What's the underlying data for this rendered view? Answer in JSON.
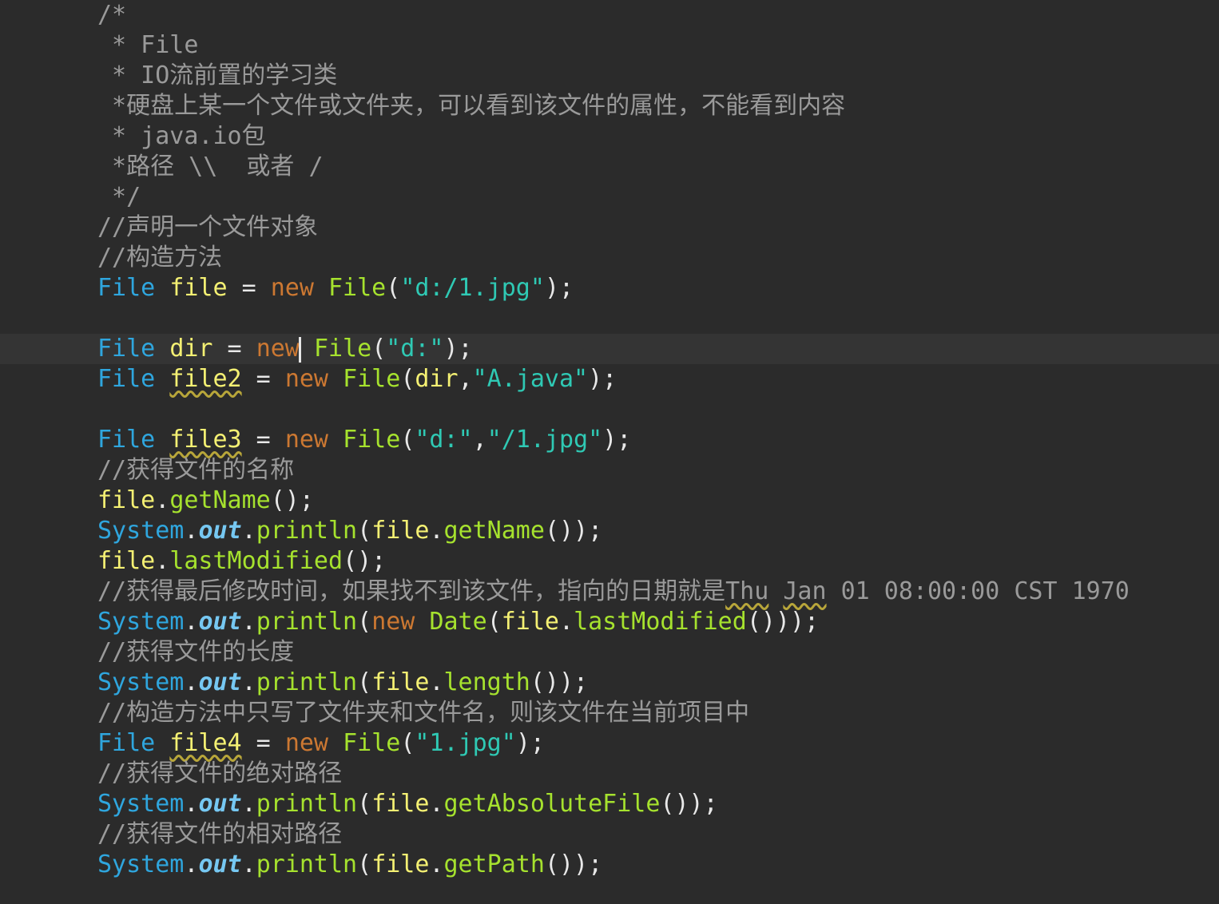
{
  "editor": {
    "current_line": 11,
    "caret_line": 11,
    "caret_after_token": 4,
    "lines": [
      [
        {
          "t": "/*",
          "c": "comment"
        }
      ],
      [
        {
          "t": " * File",
          "c": "comment"
        }
      ],
      [
        {
          "t": " * IO流前置的学习类",
          "c": "comment"
        }
      ],
      [
        {
          "t": " *硬盘上某一个文件或文件夹，可以看到该文件的属性，不能看到内容",
          "c": "comment"
        }
      ],
      [
        {
          "t": " * java.io包",
          "c": "comment"
        }
      ],
      [
        {
          "t": " *路径 \\\\  或者 /",
          "c": "comment"
        }
      ],
      [
        {
          "t": " */",
          "c": "comment"
        }
      ],
      [
        {
          "t": "//声明一个文件对象",
          "c": "comment"
        }
      ],
      [
        {
          "t": "//构造方法",
          "c": "comment"
        }
      ],
      [
        {
          "t": "File",
          "c": "type"
        },
        {
          "t": " ",
          "c": "plain"
        },
        {
          "t": "file",
          "c": "var"
        },
        {
          "t": " = ",
          "c": "punct"
        },
        {
          "t": "new",
          "c": "keyword"
        },
        {
          "t": " ",
          "c": "plain"
        },
        {
          "t": "File",
          "c": "method"
        },
        {
          "t": "(",
          "c": "punct"
        },
        {
          "t": "\"d:/1.jpg\"",
          "c": "string"
        },
        {
          "t": ");",
          "c": "punct"
        }
      ],
      [],
      [
        {
          "t": "File",
          "c": "type"
        },
        {
          "t": " ",
          "c": "plain"
        },
        {
          "t": "dir",
          "c": "var"
        },
        {
          "t": " = ",
          "c": "punct"
        },
        {
          "t": "new",
          "c": "keyword"
        },
        {
          "t": " ",
          "c": "plain"
        },
        {
          "t": "File",
          "c": "method"
        },
        {
          "t": "(",
          "c": "punct"
        },
        {
          "t": "\"d:\"",
          "c": "string"
        },
        {
          "t": ");",
          "c": "punct"
        }
      ],
      [
        {
          "t": "File",
          "c": "type"
        },
        {
          "t": " ",
          "c": "plain"
        },
        {
          "t": "file2",
          "c": "var",
          "w": 1
        },
        {
          "t": " = ",
          "c": "punct"
        },
        {
          "t": "new",
          "c": "keyword"
        },
        {
          "t": " ",
          "c": "plain"
        },
        {
          "t": "File",
          "c": "method"
        },
        {
          "t": "(",
          "c": "punct"
        },
        {
          "t": "dir",
          "c": "var"
        },
        {
          "t": ",",
          "c": "punct"
        },
        {
          "t": "\"A.java\"",
          "c": "string"
        },
        {
          "t": ");",
          "c": "punct"
        }
      ],
      [],
      [
        {
          "t": "File",
          "c": "type"
        },
        {
          "t": " ",
          "c": "plain"
        },
        {
          "t": "file3",
          "c": "var",
          "w": 1
        },
        {
          "t": " = ",
          "c": "punct"
        },
        {
          "t": "new",
          "c": "keyword"
        },
        {
          "t": " ",
          "c": "plain"
        },
        {
          "t": "File",
          "c": "method"
        },
        {
          "t": "(",
          "c": "punct"
        },
        {
          "t": "\"d:\"",
          "c": "string"
        },
        {
          "t": ",",
          "c": "punct"
        },
        {
          "t": "\"/1.jpg\"",
          "c": "string"
        },
        {
          "t": ");",
          "c": "punct"
        }
      ],
      [
        {
          "t": "//获得文件的名称",
          "c": "comment"
        }
      ],
      [
        {
          "t": "file",
          "c": "var"
        },
        {
          "t": ".",
          "c": "punct"
        },
        {
          "t": "getName",
          "c": "method"
        },
        {
          "t": "();",
          "c": "punct"
        }
      ],
      [
        {
          "t": "System",
          "c": "type"
        },
        {
          "t": ".",
          "c": "punct"
        },
        {
          "t": "out",
          "c": "field"
        },
        {
          "t": ".",
          "c": "punct"
        },
        {
          "t": "println",
          "c": "method"
        },
        {
          "t": "(",
          "c": "punct"
        },
        {
          "t": "file",
          "c": "var"
        },
        {
          "t": ".",
          "c": "punct"
        },
        {
          "t": "getName",
          "c": "method"
        },
        {
          "t": "());",
          "c": "punct"
        }
      ],
      [
        {
          "t": "file",
          "c": "var"
        },
        {
          "t": ".",
          "c": "punct"
        },
        {
          "t": "lastModified",
          "c": "method"
        },
        {
          "t": "();",
          "c": "punct"
        }
      ],
      [
        {
          "t": "//获得最后修改时间，如果找不到该文件，指向的日期就是",
          "c": "comment"
        },
        {
          "t": "Thu",
          "c": "comment",
          "w": 1
        },
        {
          "t": " ",
          "c": "comment"
        },
        {
          "t": "Jan",
          "c": "comment",
          "w": 1
        },
        {
          "t": " 01 08:00:00 CST 1970",
          "c": "comment"
        }
      ],
      [
        {
          "t": "System",
          "c": "type"
        },
        {
          "t": ".",
          "c": "punct"
        },
        {
          "t": "out",
          "c": "field"
        },
        {
          "t": ".",
          "c": "punct"
        },
        {
          "t": "println",
          "c": "method"
        },
        {
          "t": "(",
          "c": "punct"
        },
        {
          "t": "new",
          "c": "keyword"
        },
        {
          "t": " ",
          "c": "plain"
        },
        {
          "t": "Date",
          "c": "method"
        },
        {
          "t": "(",
          "c": "punct"
        },
        {
          "t": "file",
          "c": "var"
        },
        {
          "t": ".",
          "c": "punct"
        },
        {
          "t": "lastModified",
          "c": "method"
        },
        {
          "t": "()));",
          "c": "punct"
        }
      ],
      [
        {
          "t": "//获得文件的长度",
          "c": "comment"
        }
      ],
      [
        {
          "t": "System",
          "c": "type"
        },
        {
          "t": ".",
          "c": "punct"
        },
        {
          "t": "out",
          "c": "field"
        },
        {
          "t": ".",
          "c": "punct"
        },
        {
          "t": "println",
          "c": "method"
        },
        {
          "t": "(",
          "c": "punct"
        },
        {
          "t": "file",
          "c": "var"
        },
        {
          "t": ".",
          "c": "punct"
        },
        {
          "t": "length",
          "c": "method"
        },
        {
          "t": "());",
          "c": "punct"
        }
      ],
      [
        {
          "t": "//构造方法中只写了文件夹和文件名，则该文件在当前项目中",
          "c": "comment"
        }
      ],
      [
        {
          "t": "File",
          "c": "type"
        },
        {
          "t": " ",
          "c": "plain"
        },
        {
          "t": "file4",
          "c": "var",
          "w": 1
        },
        {
          "t": " = ",
          "c": "punct"
        },
        {
          "t": "new",
          "c": "keyword"
        },
        {
          "t": " ",
          "c": "plain"
        },
        {
          "t": "File",
          "c": "method"
        },
        {
          "t": "(",
          "c": "punct"
        },
        {
          "t": "\"1.jpg\"",
          "c": "string"
        },
        {
          "t": ");",
          "c": "punct"
        }
      ],
      [
        {
          "t": "//获得文件的绝对路径",
          "c": "comment"
        }
      ],
      [
        {
          "t": "System",
          "c": "type"
        },
        {
          "t": ".",
          "c": "punct"
        },
        {
          "t": "out",
          "c": "field"
        },
        {
          "t": ".",
          "c": "punct"
        },
        {
          "t": "println",
          "c": "method"
        },
        {
          "t": "(",
          "c": "punct"
        },
        {
          "t": "file",
          "c": "var"
        },
        {
          "t": ".",
          "c": "punct"
        },
        {
          "t": "getAbsoluteFile",
          "c": "method"
        },
        {
          "t": "());",
          "c": "punct"
        }
      ],
      [
        {
          "t": "//获得文件的相对路径",
          "c": "comment"
        }
      ],
      [
        {
          "t": "System",
          "c": "type"
        },
        {
          "t": ".",
          "c": "punct"
        },
        {
          "t": "out",
          "c": "field"
        },
        {
          "t": ".",
          "c": "punct"
        },
        {
          "t": "println",
          "c": "method"
        },
        {
          "t": "(",
          "c": "punct"
        },
        {
          "t": "file",
          "c": "var"
        },
        {
          "t": ".",
          "c": "punct"
        },
        {
          "t": "getPath",
          "c": "method"
        },
        {
          "t": "());",
          "c": "punct"
        }
      ]
    ]
  },
  "theme": {
    "background": "#2b2b2b",
    "current_line": "#343434",
    "comment": "#9a9a9a",
    "type": "#2fa6de",
    "keyword": "#cc7832",
    "variable": "#f4f073",
    "string": "#2fc9b4",
    "method": "#a6e22e",
    "field": "#76c8f2",
    "warning_underline": "#b8a63a"
  }
}
